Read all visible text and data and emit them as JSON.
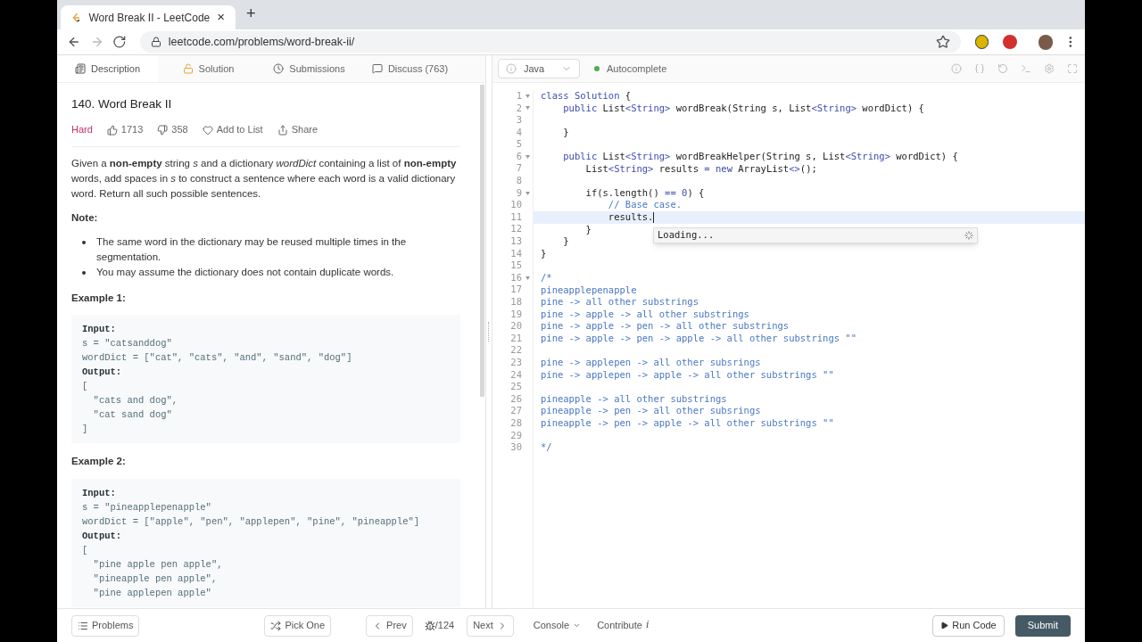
{
  "browser": {
    "tab_title": "Word Break II - LeetCode",
    "new_tab": "+",
    "close": "×",
    "url": "leetcode.com/problems/word-break-ii/"
  },
  "problem_tabs": [
    {
      "label": "Description",
      "selected": true
    },
    {
      "label": "Solution",
      "selected": false
    },
    {
      "label": "Submissions",
      "selected": false
    },
    {
      "label": "Discuss (763)",
      "selected": false
    }
  ],
  "problem": {
    "title": "140. Word Break II",
    "difficulty": "Hard",
    "likes": "1713",
    "dislikes": "358",
    "add_to_list": "Add to List",
    "share": "Share",
    "description": "Given a **non-empty** string *s* and a dictionary *wordDict* containing a list of **non-empty** words, add spaces in *s* to construct a sentence where each word is a valid dictionary word. Return all such possible sentences.",
    "note_heading": "Note:",
    "notes": [
      "The same word in the dictionary may be reused multiple times in the segmentation.",
      "You may assume the dictionary does not contain duplicate words."
    ],
    "examples": [
      {
        "heading": "Example 1:",
        "lines": [
          {
            "kind": "label",
            "text": "Input:"
          },
          {
            "kind": "code",
            "text": "s = \"catsanddog\""
          },
          {
            "kind": "code",
            "text": "wordDict = [\"cat\", \"cats\", \"and\", \"sand\", \"dog\"]"
          },
          {
            "kind": "label",
            "text": "Output:"
          },
          {
            "kind": "code",
            "text": "["
          },
          {
            "kind": "code",
            "text": "  \"cats and dog\","
          },
          {
            "kind": "code",
            "text": "  \"cat sand dog\""
          },
          {
            "kind": "code",
            "text": "]"
          }
        ]
      },
      {
        "heading": "Example 2:",
        "lines": [
          {
            "kind": "label",
            "text": "Input:"
          },
          {
            "kind": "code",
            "text": "s = \"pineapplepenapple\""
          },
          {
            "kind": "code",
            "text": "wordDict = [\"apple\", \"pen\", \"applepen\", \"pine\", \"pineapple\"]"
          },
          {
            "kind": "label",
            "text": "Output:"
          },
          {
            "kind": "code",
            "text": "["
          },
          {
            "kind": "code",
            "text": "  \"pine apple pen apple\","
          },
          {
            "kind": "code",
            "text": "  \"pineapple pen apple\","
          },
          {
            "kind": "code",
            "text": "  \"pine applepen apple\""
          }
        ]
      }
    ]
  },
  "editor": {
    "language": "Java",
    "autocomplete": {
      "label": "Autocomplete",
      "on": true
    },
    "lines": [
      {
        "number": "1",
        "foldable": true,
        "current": false,
        "tokens": [
          {
            "kind": "keyword",
            "text": "class Solution"
          },
          {
            "kind": "plain",
            "text": " {"
          }
        ]
      },
      {
        "number": "2",
        "foldable": true,
        "current": false,
        "tokens": [
          {
            "kind": "keyword",
            "text": "    public"
          },
          {
            "kind": "plain",
            "text": " List"
          },
          {
            "kind": "keyword",
            "text": "<String>"
          },
          {
            "kind": "plain",
            "text": " wordBreak(String s, List"
          },
          {
            "kind": "keyword",
            "text": "<String>"
          },
          {
            "kind": "plain",
            "text": " wordDict) {"
          }
        ]
      },
      {
        "number": "3",
        "foldable": false,
        "current": false
      },
      {
        "number": "4",
        "foldable": false,
        "current": false,
        "tokens": [
          {
            "kind": "plain",
            "text": "    }"
          }
        ]
      },
      {
        "number": "5",
        "foldable": false,
        "current": false
      },
      {
        "number": "6",
        "foldable": true,
        "current": false,
        "tokens": [
          {
            "kind": "keyword",
            "text": "    public"
          },
          {
            "kind": "plain",
            "text": " List"
          },
          {
            "kind": "keyword",
            "text": "<String>"
          },
          {
            "kind": "plain",
            "text": " wordBreakHelper(String s, List"
          },
          {
            "kind": "keyword",
            "text": "<String>"
          },
          {
            "kind": "plain",
            "text": " wordDict) {"
          }
        ]
      },
      {
        "number": "7",
        "foldable": false,
        "current": false,
        "tokens": [
          {
            "kind": "plain",
            "text": "        List"
          },
          {
            "kind": "keyword",
            "text": "<String>"
          },
          {
            "kind": "plain",
            "text": " results "
          },
          {
            "kind": "keyword",
            "text": "= new"
          },
          {
            "kind": "plain",
            "text": " ArrayList"
          },
          {
            "kind": "keyword",
            "text": "<>"
          },
          {
            "kind": "plain",
            "text": "();"
          }
        ]
      },
      {
        "number": "8",
        "foldable": false,
        "current": false
      },
      {
        "number": "9",
        "foldable": true,
        "current": false,
        "tokens": [
          {
            "kind": "plain",
            "text": "        if(s.length() "
          },
          {
            "kind": "keyword",
            "text": "== 0"
          },
          {
            "kind": "plain",
            "text": ") {"
          }
        ]
      },
      {
        "number": "10",
        "foldable": false,
        "current": false,
        "tokens": [
          {
            "kind": "comment",
            "text": "            // Base case."
          }
        ]
      },
      {
        "number": "11",
        "foldable": false,
        "current": true,
        "tokens": [
          {
            "kind": "plain",
            "text": "            results."
          }
        ]
      },
      {
        "number": "12",
        "foldable": false,
        "current": false,
        "tokens": [
          {
            "kind": "plain",
            "text": "        }"
          }
        ]
      },
      {
        "number": "13",
        "foldable": false,
        "current": false,
        "tokens": [
          {
            "kind": "plain",
            "text": "    }"
          }
        ]
      },
      {
        "number": "14",
        "foldable": false,
        "current": false,
        "tokens": [
          {
            "kind": "plain",
            "text": "}"
          }
        ]
      },
      {
        "number": "15",
        "foldable": false,
        "current": false
      },
      {
        "number": "16",
        "foldable": true,
        "current": false,
        "tokens": [
          {
            "kind": "comment",
            "text": "/*"
          }
        ]
      },
      {
        "number": "17",
        "foldable": false,
        "current": false,
        "tokens": [
          {
            "kind": "comment",
            "text": "pineapplepenapple"
          }
        ]
      },
      {
        "number": "18",
        "foldable": false,
        "current": false,
        "tokens": [
          {
            "kind": "comment",
            "text": "pine -> all other substrings"
          }
        ]
      },
      {
        "number": "19",
        "foldable": false,
        "current": false,
        "tokens": [
          {
            "kind": "comment",
            "text": "pine -> apple -> all other substrings"
          }
        ]
      },
      {
        "number": "20",
        "foldable": false,
        "current": false,
        "tokens": [
          {
            "kind": "comment",
            "text": "pine -> apple -> pen -> all other substrings"
          }
        ]
      },
      {
        "number": "21",
        "foldable": false,
        "current": false,
        "tokens": [
          {
            "kind": "comment",
            "text": "pine -> apple -> pen -> apple -> all other substrings \"\""
          }
        ]
      },
      {
        "number": "22",
        "foldable": false,
        "current": false
      },
      {
        "number": "23",
        "foldable": false,
        "current": false,
        "tokens": [
          {
            "kind": "comment",
            "text": "pine -> applepen -> all other subsrings"
          }
        ]
      },
      {
        "number": "24",
        "foldable": false,
        "current": false,
        "tokens": [
          {
            "kind": "comment",
            "text": "pine -> applepen -> apple -> all other substrings \"\""
          }
        ]
      },
      {
        "number": "25",
        "foldable": false,
        "current": false
      },
      {
        "number": "26",
        "foldable": false,
        "current": false,
        "tokens": [
          {
            "kind": "comment",
            "text": "pineapple -> all other substrings"
          }
        ]
      },
      {
        "number": "27",
        "foldable": false,
        "current": false,
        "tokens": [
          {
            "kind": "comment",
            "text": "pineapple -> pen -> all other subsrings"
          }
        ]
      },
      {
        "number": "28",
        "foldable": false,
        "current": false,
        "tokens": [
          {
            "kind": "comment",
            "text": "pineapple -> pen -> apple -> all other substrings \"\""
          }
        ]
      },
      {
        "number": "29",
        "foldable": false,
        "current": false
      },
      {
        "number": "30",
        "foldable": false,
        "current": false,
        "tokens": [
          {
            "kind": "comment",
            "text": "*/"
          }
        ]
      }
    ],
    "suggestion_popup": {
      "text": "Loading..."
    }
  },
  "bottom_bar": {
    "problems": "Problems",
    "pick_one": "Pick One",
    "prev": "Prev",
    "counter": "/124",
    "next": "Next",
    "console": "Console",
    "contribute": "Contribute",
    "contribute_icon": "i",
    "run_code": "Run Code",
    "submit": "Submit"
  }
}
